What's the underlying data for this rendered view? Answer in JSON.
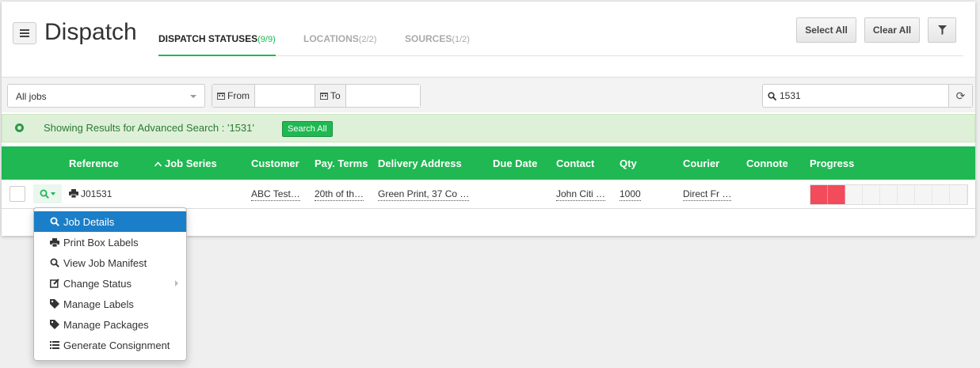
{
  "header": {
    "title": "Dispatch",
    "tabs": [
      {
        "label": "DISPATCH STATUSES",
        "count": "(9/9)",
        "active": true
      },
      {
        "label": "LOCATIONS",
        "count": "(2/2)",
        "active": false
      },
      {
        "label": "SOURCES",
        "count": "(1/2)",
        "active": false
      }
    ],
    "select_all_label": "Select All",
    "clear_all_label": "Clear All"
  },
  "filters": {
    "jobs_select": "All jobs",
    "from_label": "From",
    "from_value": "",
    "to_label": "To",
    "to_value": "",
    "search_value": "1531"
  },
  "alert": {
    "text": "Showing Results for Advanced Search : '1531'",
    "button_label": "Search All"
  },
  "table": {
    "columns": [
      "Reference",
      "Job Series",
      "Customer",
      "Pay. Terms",
      "Delivery Address",
      "Due Date",
      "Contact",
      "Qty",
      "Courier",
      "Connote",
      "Progress"
    ],
    "rows": [
      {
        "reference": "J01531",
        "job_series": "",
        "customer": "ABC Test…",
        "pay_terms": "20th of th…",
        "delivery_address": "Green Print, 37 Co …",
        "due_date": "",
        "contact": "John Citi …",
        "qty": "1000",
        "courier": "Direct Fr …",
        "connote": "",
        "progress": {
          "completed_segments": 2,
          "total_segments": 9
        }
      }
    ]
  },
  "menu": {
    "items": [
      {
        "label": "Job Details",
        "icon": "search-icon",
        "active": true
      },
      {
        "label": "Print Box Labels",
        "icon": "printer-icon",
        "active": false
      },
      {
        "label": "View Job Manifest",
        "icon": "search-icon",
        "active": false
      },
      {
        "label": "Change Status",
        "icon": "edit-icon",
        "active": false,
        "submenu": true
      },
      {
        "label": "Manage Labels",
        "icon": "tag-icon",
        "active": false
      },
      {
        "label": "Manage Packages",
        "icon": "tag-icon",
        "active": false
      },
      {
        "label": "Generate Consignment",
        "icon": "list-icon",
        "active": false
      }
    ]
  },
  "colors": {
    "accent_green": "#1fb852",
    "menu_highlight": "#1b7ec8",
    "progress_red": "#f24b5c"
  }
}
